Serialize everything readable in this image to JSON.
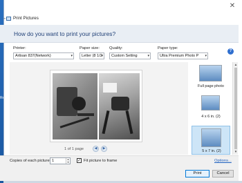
{
  "window": {
    "title": "Print Pictures",
    "close_glyph": "✕",
    "back_glyph": "←"
  },
  "header": {
    "question": "How do you want to print your pictures?"
  },
  "options": {
    "printer_label": "Printer:",
    "printer_value": "Artisan 837(Network)",
    "paper_size_label": "Paper size:",
    "paper_size_value": "Letter (8 1/2",
    "quality_label": "Quality:",
    "quality_value": "Custom Setting",
    "paper_type_label": "Paper type:",
    "paper_type_value": "Ultra Premium Photo P",
    "help_glyph": "?"
  },
  "preview": {
    "page_info": "1 of 1 page",
    "prev_glyph": "◀",
    "next_glyph": "▶"
  },
  "layouts": {
    "items": [
      {
        "label": "Full page photo"
      },
      {
        "label": "4 x 6 in. (2)"
      },
      {
        "label": "5 x 7 in. (2)"
      }
    ],
    "selected_index": 2,
    "scroll_up": "▲",
    "scroll_down": "▼"
  },
  "footer": {
    "copies_label": "Copies of each picture:",
    "copies_value": "1",
    "fit_label": "Fit picture to frame",
    "fit_checked": "✓",
    "options_link": "Options...",
    "print_button": "Print",
    "cancel_button": "Cancel"
  },
  "colors": {
    "accent": "#2f6fcf",
    "header_text": "#1f3f76",
    "selected_bg": "#cde5f7",
    "desktop": "#1f5fa5"
  }
}
